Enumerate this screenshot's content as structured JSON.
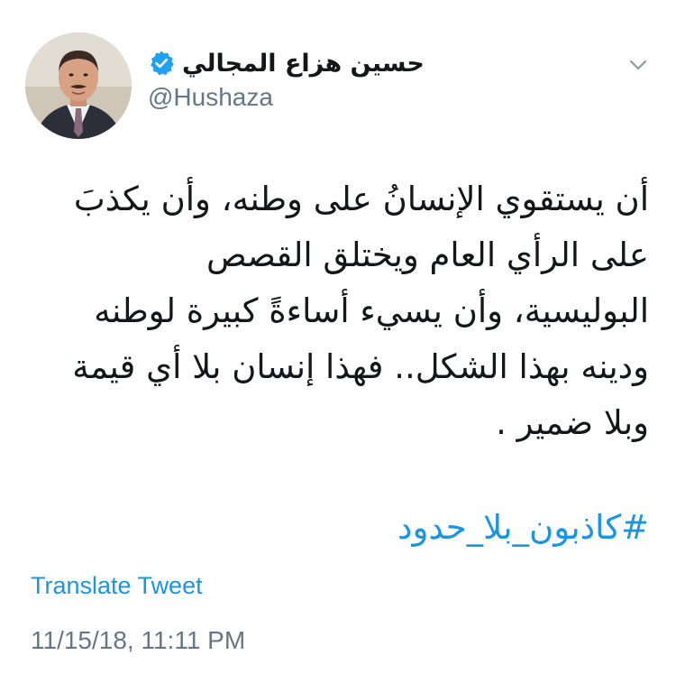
{
  "tweet": {
    "author_name": "حسين هزاع المجالي",
    "handle": "@Hushaza",
    "verified": true,
    "text_lines": [
      "أن يستقوي الإنسانُ على وطنه، وأن يكذبَ",
      "على الرأي العام ويختلق القصص",
      "البوليسية، وأن يسيء أساءةً كبيرة لوطنه",
      "ودينه بهذا الشكل.. فهذا إنسان بلا أي قيمة",
      "وبلا ضمير ."
    ],
    "hashtag": "#كاذبون_بلا_حدود",
    "translate_label": "Translate Tweet",
    "timestamp": "11/15/18, 11:11 PM"
  },
  "icons": {
    "menu": "chevron-down-icon",
    "verified": "verified-badge-icon"
  },
  "colors": {
    "link": "#1b95e0",
    "verified": "#1da1f2",
    "secondary_text": "#657786",
    "primary_text": "#14171a"
  }
}
